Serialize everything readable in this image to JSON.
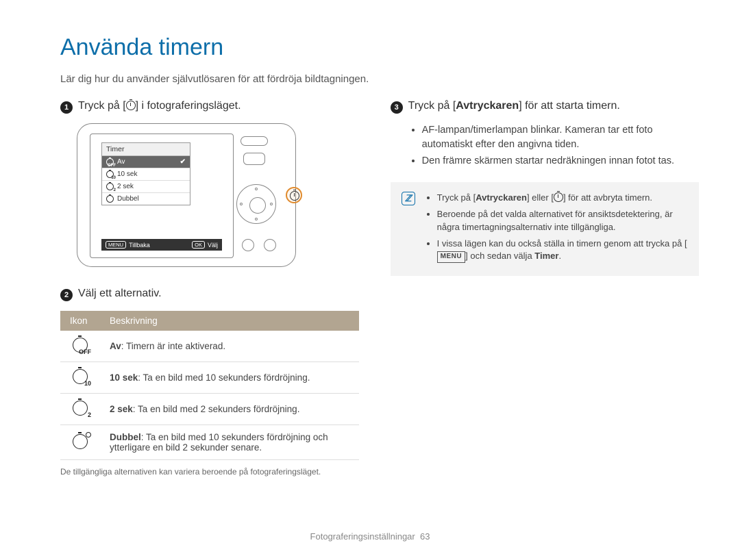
{
  "title": "Använda timern",
  "subtitle": "Lär dig hur du använder självutlösaren för att fördröja bildtagningen.",
  "left": {
    "step1_pre": "Tryck på [",
    "step1_post": "] i fotograferingsläget.",
    "camera_menu": {
      "title": "Timer",
      "items": [
        "Av",
        "10 sek",
        "2 sek",
        "Dubbel"
      ],
      "bar_back_pill": "MENU",
      "bar_back": "Tillbaka",
      "bar_ok_pill": "OK",
      "bar_ok": "Välj"
    },
    "step2": "Välj ett alternativ.",
    "table": {
      "h_icon": "Ikon",
      "h_desc": "Beskrivning",
      "rows": [
        {
          "sub": "OFF",
          "bold": "Av",
          "rest": ": Timern är inte aktiverad."
        },
        {
          "sub": "10",
          "bold": "10 sek",
          "rest": ": Ta en bild med 10 sekunders fördröjning."
        },
        {
          "sub": "2",
          "bold": "2 sek",
          "rest": ": Ta en bild med 2 sekunders fördröjning."
        },
        {
          "sub": "",
          "dbl": true,
          "bold": "Dubbel",
          "rest": ": Ta en bild med 10 sekunders fördröjning och ytterligare en bild 2 sekunder senare."
        }
      ],
      "note": "De tillgängliga alternativen kan variera beroende på fotograferingsläget."
    }
  },
  "right": {
    "step3_pre": "Tryck på [",
    "step3_b": "Avtryckaren",
    "step3_post": "] för att starta timern.",
    "bullets": [
      "AF-lampan/timerlampan blinkar. Kameran tar ett foto automatiskt efter den angivna tiden.",
      "Den främre skärmen startar nedräkningen innan fotot tas."
    ],
    "note": {
      "li1_a": "Tryck på [",
      "li1_b": "Avtryckaren",
      "li1_c": "] eller [",
      "li1_d": "] för att avbryta timern.",
      "li2": "Beroende på det valda alternativet för ansiktsdetektering, är några timertagningsalternativ inte tillgängliga.",
      "li3_a": "I vissa lägen kan du också ställa in timern genom att trycka på [",
      "li3_b": "] och sedan välja ",
      "li3_c": "Timer",
      "li3_d": "."
    }
  },
  "footer_section": "Fotograferingsinställningar",
  "footer_page": "63"
}
